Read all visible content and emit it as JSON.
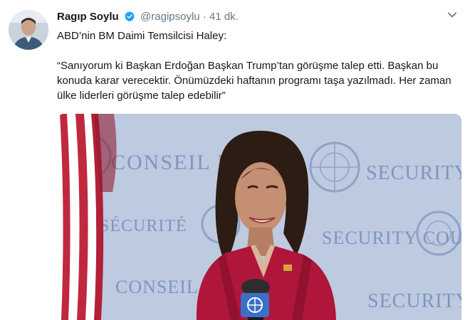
{
  "tweet": {
    "author_name": "Ragıp Soylu",
    "handle": "@ragipsoylu",
    "separator": "·",
    "time": "41 dk.",
    "line1": "ABD’nin BM Daimi Temsilcisi Haley:",
    "quote": "“Sanıyorum ki Başkan Erdoğan Başkan Trump’tan görüşme talep etti. Başkan bu konuda karar verecektir. Önümüzdeki haftanın programı taşa yazılmadı. Her zaman ülke liderleri görüşme talep edebilir”"
  },
  "media": {
    "wall_text_1": "CONSEIL DE",
    "wall_text_2": "SECURITY",
    "wall_text_3": "SÉCURITÉ",
    "wall_text_4": "SECURITY COUNCIL",
    "wall_text_5": "CONSEIL",
    "wall_text_6": "SECURITY"
  },
  "colors": {
    "verified": "#1da1f2",
    "wall": "#b9c6de",
    "jacket": "#b0163a"
  }
}
